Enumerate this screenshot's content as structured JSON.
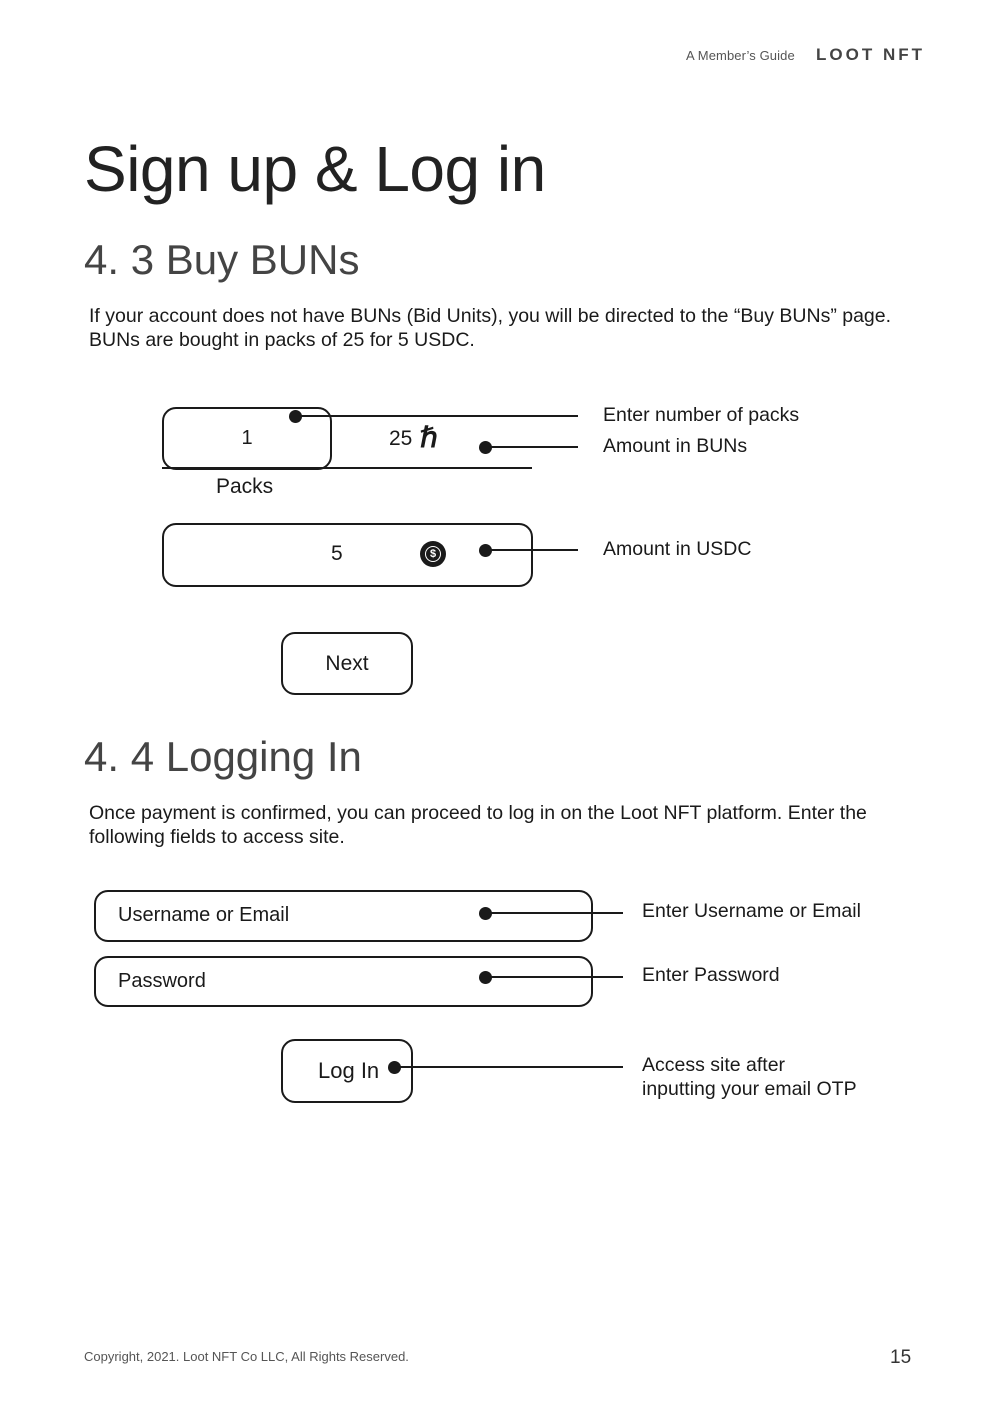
{
  "header": {
    "guide_label": "A Member’s Guide",
    "logo_text": "LOOT NFT"
  },
  "page_title": "Sign up & Log in",
  "section_buy": {
    "heading": "4. 3 Buy BUNs",
    "paragraph_line1": "If your account does not have BUNs (Bid Units), you will be directed to the “Buy BUNs” page.",
    "paragraph_line2": "BUNs are bought in packs of 25 for 5 USDC.",
    "packs_value": "1",
    "packs_label": "Packs",
    "buns_amount": "25",
    "buns_symbol": "ℏ",
    "usdc_amount": "5",
    "usdc_icon": "usdc-coin-icon",
    "next_button": "Next",
    "callouts": {
      "packs": "Enter number of packs",
      "buns": "Amount in BUNs",
      "usdc": "Amount in USDC"
    }
  },
  "section_login": {
    "heading": "4. 4 Logging In",
    "paragraph_line1": "Once payment is confirmed, you can proceed to log in on the Loot NFT platform. Enter the",
    "paragraph_line2": "following fields to access site.",
    "username_placeholder": "Username or Email",
    "password_placeholder": "Password",
    "login_button": "Log In",
    "callouts": {
      "username": "Enter Username or Email",
      "password": "Enter Password",
      "login_line1": "Access site after",
      "login_line2": "inputting your email OTP"
    }
  },
  "footer": {
    "copyright": "Copyright, 2021. Loot NFT Co LLC, All Rights Reserved.",
    "page_number": "15"
  }
}
